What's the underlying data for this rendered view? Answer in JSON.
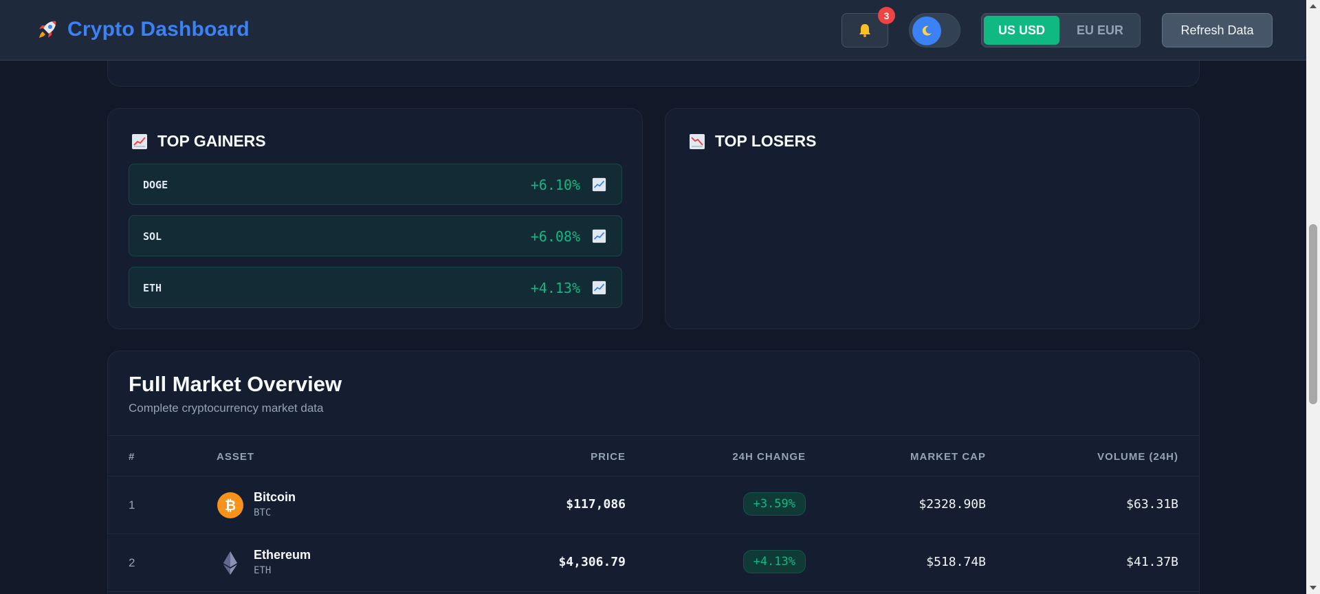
{
  "header": {
    "title": "Crypto Dashboard",
    "notification_count": "3",
    "currency_options": [
      "US USD",
      "EU EUR"
    ],
    "selected_currency": "US USD",
    "refresh_label": "Refresh Data"
  },
  "gainers": {
    "title": "TOP GAINERS",
    "items": [
      {
        "symbol": "DOGE",
        "change": "+6.10%"
      },
      {
        "symbol": "SOL",
        "change": "+6.08%"
      },
      {
        "symbol": "ETH",
        "change": "+4.13%"
      }
    ]
  },
  "losers": {
    "title": "TOP LOSERS",
    "items": []
  },
  "market": {
    "title": "Full Market Overview",
    "subtitle": "Complete cryptocurrency market data",
    "columns": [
      "#",
      "ASSET",
      "PRICE",
      "24H CHANGE",
      "MARKET CAP",
      "VOLUME (24H)"
    ],
    "rows": [
      {
        "rank": "1",
        "name": "Bitcoin",
        "symbol": "BTC",
        "price": "$117,086",
        "change": "+3.59%",
        "market_cap": "$2328.90B",
        "volume": "$63.31B",
        "icon": "bitcoin-icon"
      },
      {
        "rank": "2",
        "name": "Ethereum",
        "symbol": "ETH",
        "price": "$4,306.79",
        "change": "+4.13%",
        "market_cap": "$518.74B",
        "volume": "$41.37B",
        "icon": "ethereum-icon"
      }
    ]
  },
  "colors": {
    "brand": "#3b82f6",
    "positive": "#10b981",
    "badge": "#ef4444",
    "background": "#111827"
  }
}
